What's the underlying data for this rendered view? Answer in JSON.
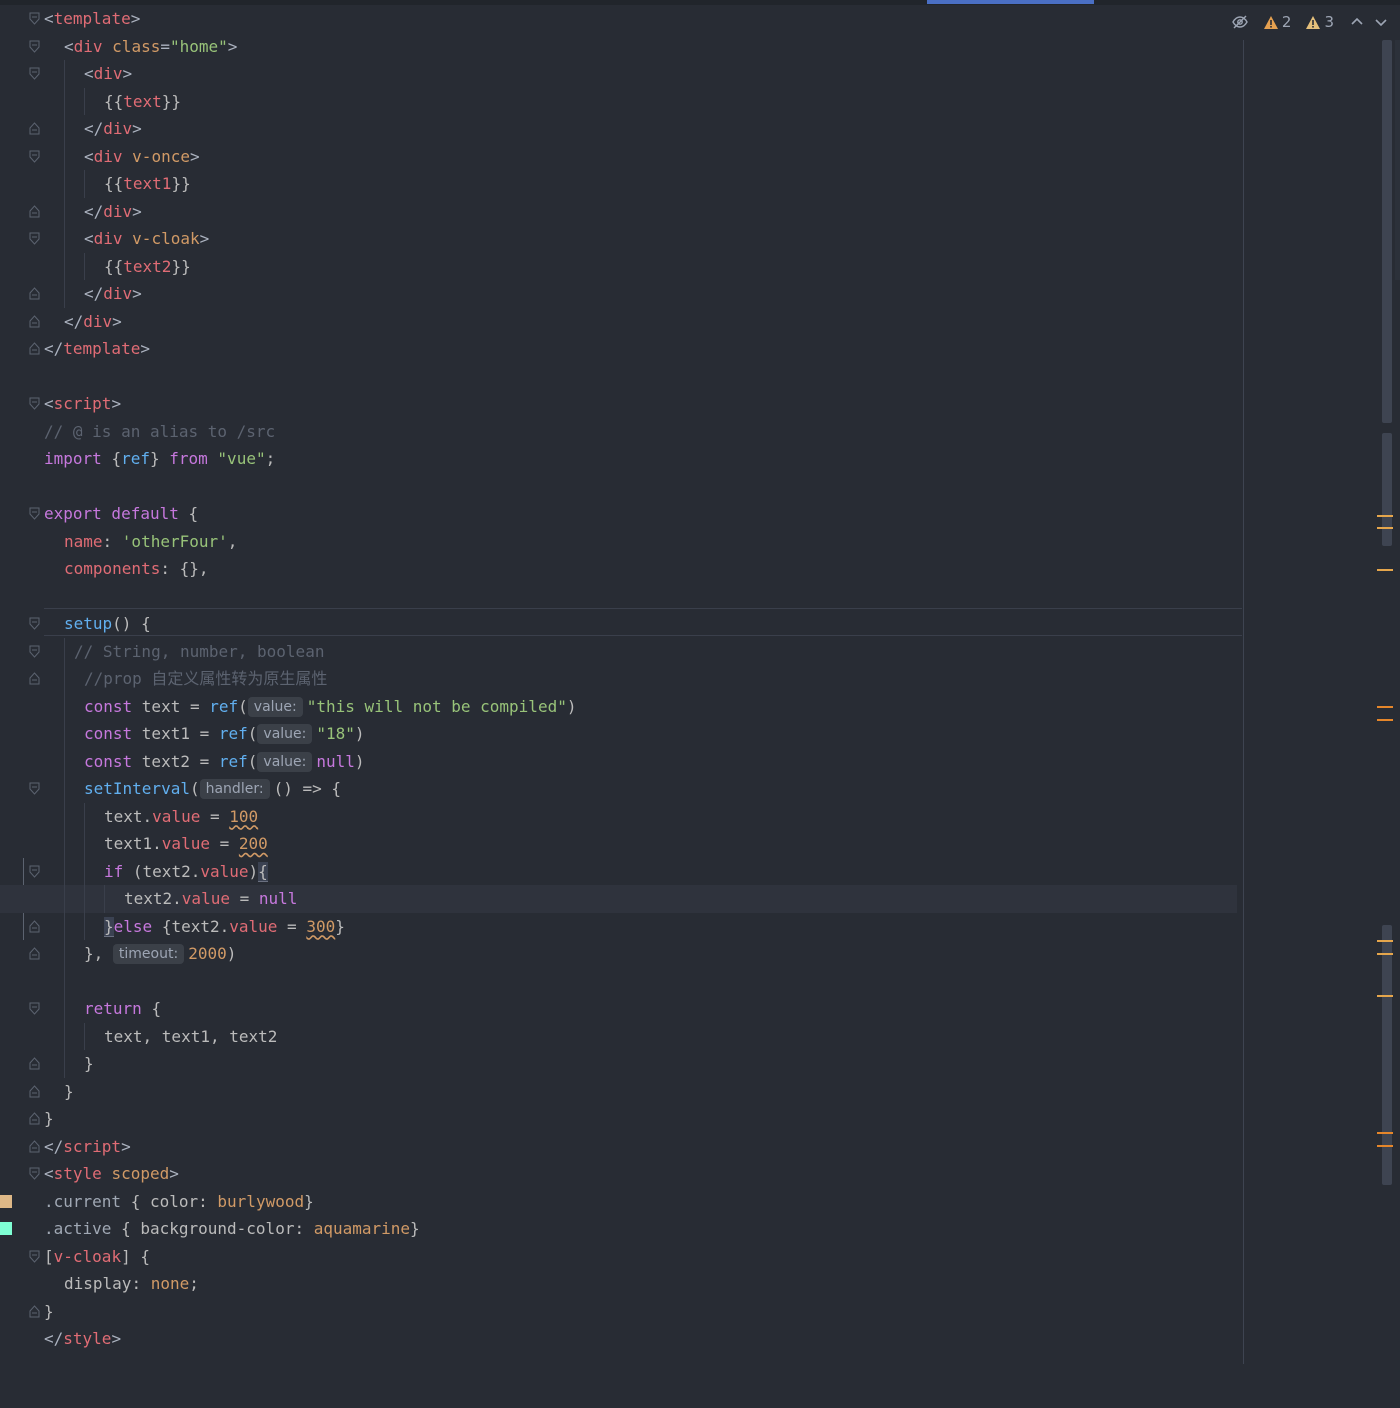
{
  "status": {
    "inspection_icon": "eye-crossed-icon",
    "errors_count": "2",
    "warnings_count": "3",
    "prev_icon": "chevron-up-icon",
    "next_icon": "chevron-down-icon"
  },
  "hints": {
    "value": "value:",
    "handler": "handler:",
    "timeout": "timeout:"
  },
  "code": {
    "l1": {
      "a": "<",
      "b": "template",
      "c": ">"
    },
    "l2": {
      "a": "<",
      "b": "div ",
      "c": "class",
      "d": "=",
      "e": "\"home\"",
      "f": ">"
    },
    "l3": {
      "a": "<",
      "b": "div",
      "c": ">"
    },
    "l4": {
      "a": "{{",
      "b": "text",
      "c": "}}"
    },
    "l5": {
      "a": "</",
      "b": "div",
      "c": ">"
    },
    "l6": {
      "a": "<",
      "b": "div ",
      "c": "v-once",
      "d": ">"
    },
    "l7": {
      "a": "{{",
      "b": "text1",
      "c": "}}"
    },
    "l8": {
      "a": "</",
      "b": "div",
      "c": ">"
    },
    "l9": {
      "a": "<",
      "b": "div ",
      "c": "v-cloak",
      "d": ">"
    },
    "l10": {
      "a": "{{",
      "b": "text2",
      "c": "}}"
    },
    "l11": {
      "a": "</",
      "b": "div",
      "c": ">"
    },
    "l12": {
      "a": "</",
      "b": "div",
      "c": ">"
    },
    "l13": {
      "a": "</",
      "b": "template",
      "c": ">"
    },
    "l15": {
      "a": "<",
      "b": "script",
      "c": ">"
    },
    "l16": {
      "a": "// @ is an alias to /src"
    },
    "l17": {
      "a": "import ",
      "b": "{",
      "c": "ref",
      "d": "} ",
      "e": "from ",
      "f": "\"vue\"",
      "g": ";"
    },
    "l19": {
      "a": "export default ",
      "b": "{"
    },
    "l20": {
      "a": "name",
      "b": ": ",
      "c": "'otherFour'",
      "d": ","
    },
    "l21": {
      "a": "components",
      "b": ": {},"
    },
    "l23": {
      "a": "setup",
      "b": "() {"
    },
    "l24": {
      "a": "// String, number, boolean"
    },
    "l25": {
      "a": "//prop 自定义属性转为原生属性"
    },
    "l26": {
      "a": "const ",
      "b": "text = ",
      "c": "ref",
      "d": "(",
      "e": "\"this will not be compiled\"",
      "f": ")"
    },
    "l27": {
      "a": "const ",
      "b": "text1 = ",
      "c": "ref",
      "d": "(",
      "e": "\"18\"",
      "f": ")"
    },
    "l28": {
      "a": "const ",
      "b": "text2 = ",
      "c": "ref",
      "d": "(",
      "e": "null",
      "f": ")"
    },
    "l29": {
      "a": "setInterval",
      "b": "(",
      "c": "() => {"
    },
    "l30": {
      "a": "text.",
      "b": "value",
      "c": " = ",
      "d": "100"
    },
    "l31": {
      "a": "text1.",
      "b": "value",
      "c": " = ",
      "d": "200"
    },
    "l32": {
      "a": "if ",
      "b": "(text2.",
      "c": "value",
      "d": ")",
      "e": "{"
    },
    "l33": {
      "a": "text2.",
      "b": "value",
      "c": " = ",
      "d": "null"
    },
    "l34": {
      "a": "}",
      "b": "else ",
      "c": "{text2.",
      "d": "value",
      "e": " = ",
      "f": "300",
      "g": "}"
    },
    "l35": {
      "a": "}, ",
      "b": "2000",
      "c": ")"
    },
    "l37": {
      "a": "return ",
      "b": "{"
    },
    "l38": {
      "a": "text, text1, text2"
    },
    "l39": {
      "a": "}"
    },
    "l40": {
      "a": "}"
    },
    "l41": {
      "a": "}"
    },
    "l42": {
      "a": "</",
      "b": "script",
      "c": ">"
    },
    "l43": {
      "a": "<",
      "b": "style ",
      "c": "scoped",
      "d": ">"
    },
    "l44": {
      "a": ".current ",
      "b": "{ ",
      "c": "color",
      "d": ": ",
      "e": "burlywood",
      "f": "}"
    },
    "l45": {
      "a": ".active ",
      "b": "{ ",
      "c": "background-color",
      "d": ": ",
      "e": "aquamarine",
      "f": "}"
    },
    "l46": {
      "a": "[",
      "b": "v-cloak",
      "c": "] {"
    },
    "l47": {
      "a": "display",
      "b": ": ",
      "c": "none",
      "d": ";"
    },
    "l48": {
      "a": "}"
    },
    "l49": {
      "a": "</",
      "b": "style",
      "c": ">"
    }
  },
  "swatches": {
    "burlywood": "#deb887",
    "aquamarine": "#7fffd4"
  }
}
